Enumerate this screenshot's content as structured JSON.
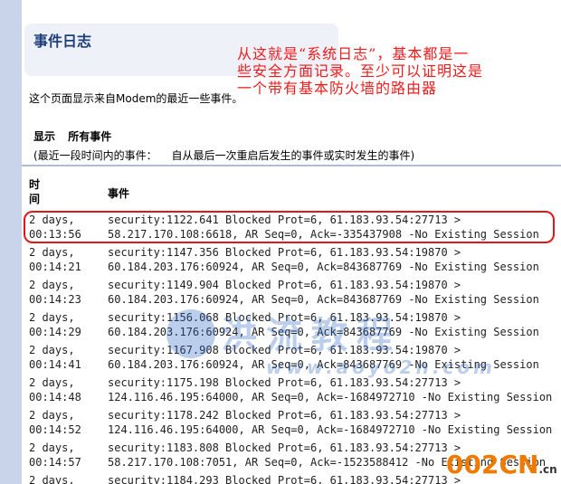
{
  "header": {
    "title": "事件日志"
  },
  "annotation": {
    "lines": [
      "从这就是“系统日志”，基本都是一",
      "些安全方面记录。至少可以证明这是",
      "一个带有基本防火墙的路由器"
    ]
  },
  "description": "这个页面显示来自Modem的最近一些事件。",
  "filter": {
    "label": "显示",
    "value": "所有事件",
    "note_prefix": "(最近一段时间内的事件：",
    "note_suffix": "自从最后一次重启后发生的事件或实时发生的事件)"
  },
  "table": {
    "col_time": "时间",
    "col_event": "事件",
    "rows": [
      {
        "time1": "2 days,",
        "time2": "00:13:56",
        "event1": "security:1122.641 Blocked Prot=6, 61.183.93.54:27713 >",
        "event2": "58.217.170.108:6618, AR Seq=0, Ack=-335437908 -No Existing Session"
      },
      {
        "time1": "2 days,",
        "time2": "00:14:21",
        "event1": "security:1147.356 Blocked Prot=6, 61.183.93.54:19870 >",
        "event2": "60.184.203.176:60924, AR Seq=0, Ack=843687769 -No Existing Session"
      },
      {
        "time1": "2 days,",
        "time2": "00:14:23",
        "event1": "security:1149.904 Blocked Prot=6, 61.183.93.54:19870 >",
        "event2": "60.184.203.176:60924, AR Seq=0, Ack=843687769 -No Existing Session"
      },
      {
        "time1": "2 days,",
        "time2": "00:14:29",
        "event1": "security:1156.068 Blocked Prot=6, 61.183.93.54:19870 >",
        "event2": "60.184.203.176:60924, AR Seq=0, Ack=843687769 -No Existing Session"
      },
      {
        "time1": "2 days,",
        "time2": "00:14:41",
        "event1": "security:1167.908 Blocked Prot=6, 61.183.93.54:19870 >",
        "event2": "60.184.203.176:60924, AR Seq=0, Ack=843687769 -No Existing Session"
      },
      {
        "time1": "2 days,",
        "time2": "00:14:48",
        "event1": "security:1175.198 Blocked Prot=6, 61.183.93.54:27713 >",
        "event2": "124.116.46.195:64000, AR Seq=0, Ack=-1684972710 -No Existing Session"
      },
      {
        "time1": "2 days,",
        "time2": "00:14:52",
        "event1": "security:1178.242 Blocked Prot=6, 61.183.93.54:27713 >",
        "event2": "124.116.46.195:64000, AR Seq=0, Ack=-1684972710 -No Existing Session"
      },
      {
        "time1": "2 days,",
        "time2": "00:14:57",
        "event1": "security:1183.808 Blocked Prot=6, 61.183.93.54:27713 >",
        "event2": "58.217.170.108:7051, AR Seq=0, Ack=-1523588412 -No Existing Session"
      },
      {
        "time1": "2 days,",
        "time2": "",
        "event1": "security:1184.293 Blocked Prot=6, 61.183.93.54:27713 >",
        "event2": ""
      }
    ]
  },
  "watermark": {
    "text": "洪流教程",
    "url": "www.aoyo2n.com"
  },
  "site_logo": {
    "main": "002CN",
    "domain": ".cn"
  },
  "colors": {
    "title": "#1f3f7a",
    "annotation": "#ee1c1c",
    "highlight": "#e01818",
    "background": "#c9d3ea"
  }
}
